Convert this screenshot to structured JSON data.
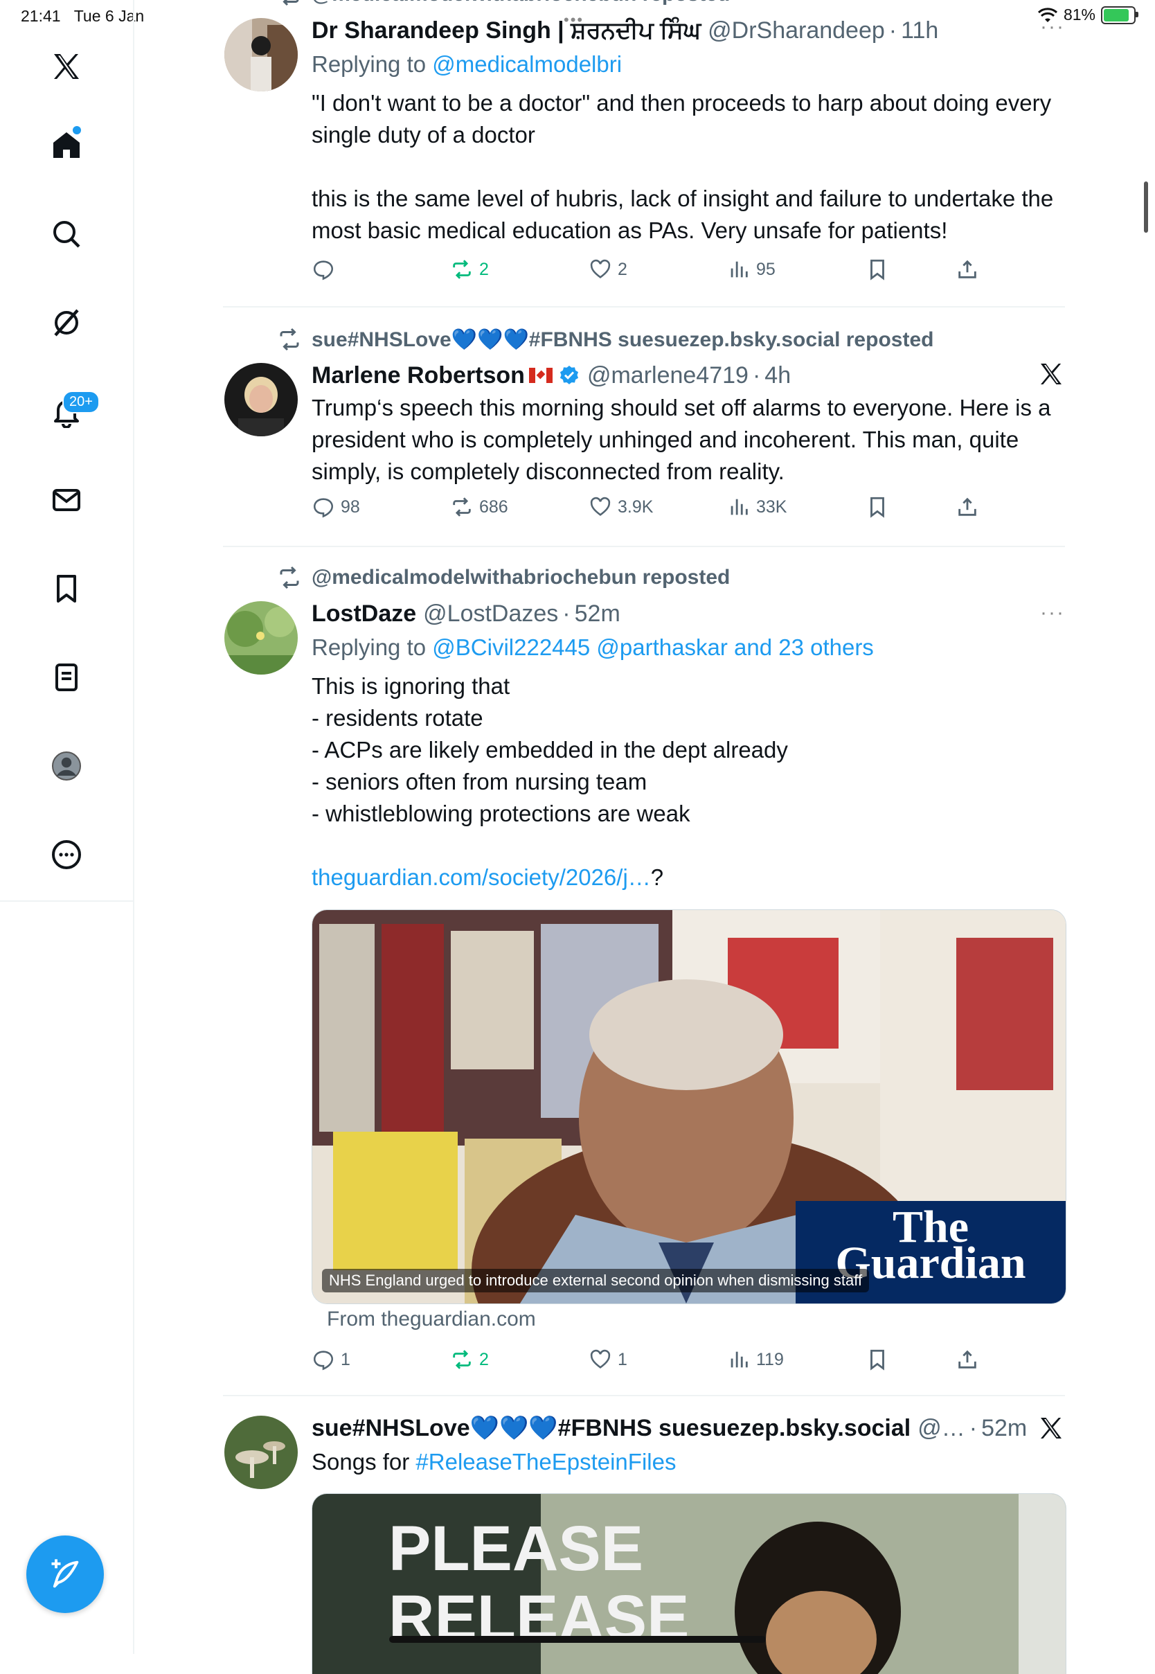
{
  "status_bar": {
    "time": "21:41",
    "date": "Tue 6 Jan",
    "battery": "81%"
  },
  "nav": {
    "items": [
      "Home",
      "Search",
      "Grok",
      "Notifications",
      "Messages",
      "Bookmarks",
      "Lists",
      "Profile",
      "More"
    ],
    "notifications_badge": "20+"
  },
  "tweets": [
    {
      "repost_by": "@medicalmodelwithabriochebun reposted",
      "name": "Dr Sharandeep Singh | ਸ਼ਰਨਦੀਪ ਸਿੰਘ",
      "handle": "@DrSharandeep",
      "time": "11h",
      "replying_prefix": "Replying to",
      "replying_to": "@medicalmodelbri",
      "body": "\"I don't want to be a doctor\" and then proceeds to harp about doing every single duty of a doctor\n\nthis is the same level of hubris, lack of insight and failure to undertake the most basic medical education as PAs. Very unsafe for patients!",
      "stats": {
        "replies": "",
        "reposts": "2",
        "likes": "2",
        "views": "95"
      }
    },
    {
      "repost_by": "sue#NHSLove💙💙💙#FBNHS suesuezep.bsky.social reposted",
      "name": "Marlene Robertson",
      "handle": "@marlene4719",
      "time": "4h",
      "body": "Trump‘s speech this morning should set off alarms to everyone.   Here is a president who is completely unhinged and incoherent.  This man, quite simply, is completely disconnected from reality.",
      "stats": {
        "replies": "98",
        "reposts": "686",
        "likes": "3.9K",
        "views": "33K"
      }
    },
    {
      "repost_by": "@medicalmodelwithabriochebun reposted",
      "name": "LostDaze",
      "handle": "@LostDazes",
      "time": "52m",
      "replying_prefix": "Replying to",
      "replying_to": "@BCivil222445 @parthaskar and 23 others",
      "body": "This is ignoring that\n- residents rotate\n- ACPs are likely embedded in the dept already\n- seniors often from nursing team\n- whistleblowing protections are weak",
      "link_text": "theguardian.com/society/2026/j…",
      "link_suffix": "?",
      "card_caption": "NHS England urged to introduce external second opinion when dismissing staff",
      "card_logo_line1": "The",
      "card_logo_line2": "Guardian",
      "card_source": "From theguardian.com",
      "stats": {
        "replies": "1",
        "reposts": "2",
        "likes": "1",
        "views": "119"
      }
    },
    {
      "name_part1": "sue#NHSLove",
      "name_hearts": "💙💙💙",
      "name_part2": "#FBNHS suesuezep.bsky.social",
      "handle": "@…",
      "time": "52m",
      "body_prefix": "Songs for",
      "hashtag": "#ReleaseTheEpsteinFiles",
      "image_text_line1": "PLEASE",
      "image_text_line2": "RELEASE"
    }
  ]
}
